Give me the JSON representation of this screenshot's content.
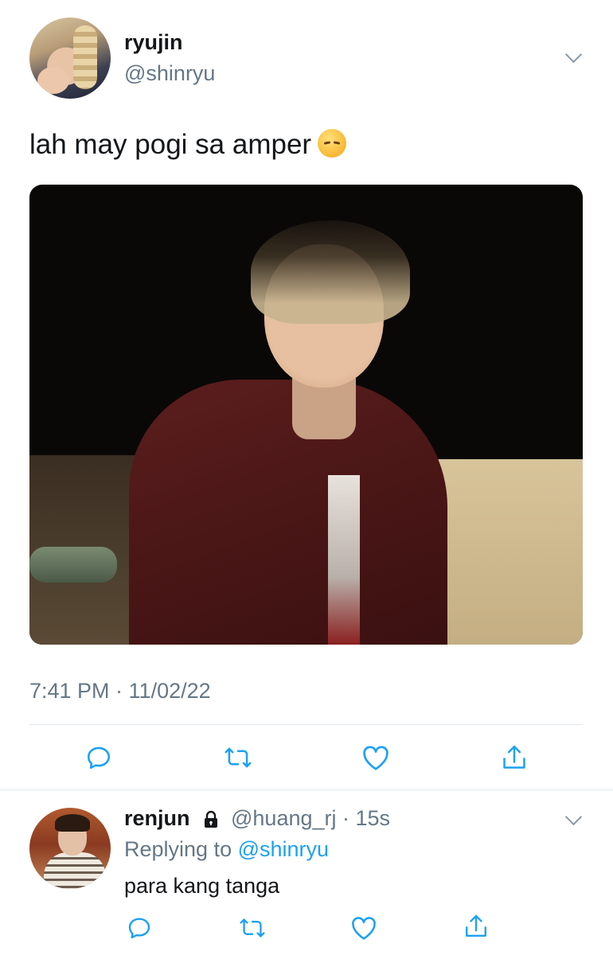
{
  "tweet": {
    "name": "ryujin",
    "handle": "@shinryu",
    "text": "lah may pogi sa amper",
    "emoji_icon": "pensive-face-emoji",
    "timestamp": "7:41 PM · 11/02/22"
  },
  "reply": {
    "name": "renjun",
    "handle_time": "@huang_rj · 15s",
    "replying_prefix": "Replying to",
    "replying_to": "@shinryu",
    "text": "para kang tanga"
  },
  "icons": [
    "chevron-down-icon",
    "reply-icon",
    "retweet-icon",
    "like-icon",
    "share-icon",
    "lock-icon"
  ],
  "colors": {
    "text": "#14171a",
    "muted": "#657786",
    "link": "#1da1f2",
    "divider": "#e1e8ed",
    "icon": "#1da1f2"
  }
}
